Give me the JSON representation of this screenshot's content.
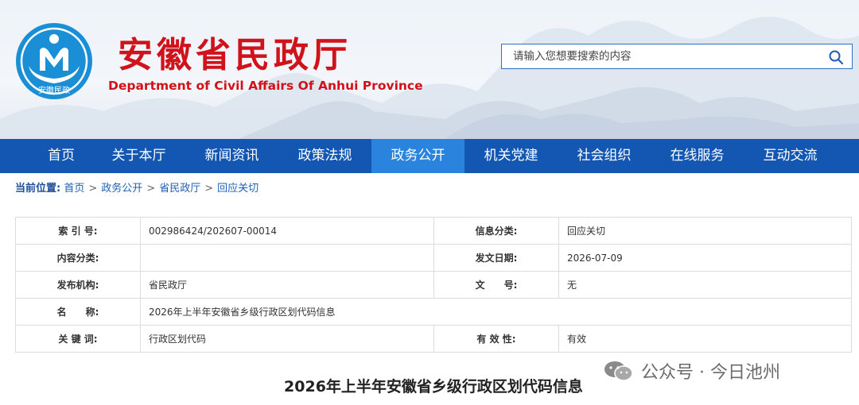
{
  "header": {
    "title_cn": "安徽省民政厅",
    "title_en": "Department of Civil Affairs Of Anhui Province",
    "logo_text": "安徽民政"
  },
  "search": {
    "placeholder": "请输入您想要搜索的内容"
  },
  "nav": {
    "items": [
      "首页",
      "关于本厅",
      "新闻资讯",
      "政策法规",
      "政务公开",
      "机关党建",
      "社会组织",
      "在线服务",
      "互动交流"
    ],
    "active": "政务公开"
  },
  "breadcrumb": {
    "label": "当前位置:",
    "items": [
      "首页",
      "政务公开",
      "省民政厅",
      "回应关切"
    ],
    "separator": ">"
  },
  "meta": {
    "index_label": "索 引 号:",
    "index_value": "002986424/202607-00014",
    "info_category_label": "信息分类:",
    "info_category_value": "回应关切",
    "content_category_label": "内容分类:",
    "content_category_value": "",
    "publish_date_label": "发文日期:",
    "publish_date_value": "2026-07-09",
    "publisher_label": "发布机构:",
    "publisher_value": "省民政厅",
    "doc_no_label": "文　　号:",
    "doc_no_value": "无",
    "name_label": "名　　称:",
    "name_value": "2026年上半年安徽省乡级行政区划代码信息",
    "keywords_label": "关 键 词:",
    "keywords_value": "行政区划代码",
    "validity_label": "有 效 性:",
    "validity_value": "有效"
  },
  "article": {
    "title": "2026年上半年安徽省乡级行政区划代码信息"
  },
  "watermark": {
    "text": "公众号 · 今日池州"
  },
  "colors": {
    "brand_red": "#d0121b",
    "nav_blue": "#1357b2",
    "nav_active": "#2a83dd",
    "link_blue": "#1e5fb3"
  }
}
